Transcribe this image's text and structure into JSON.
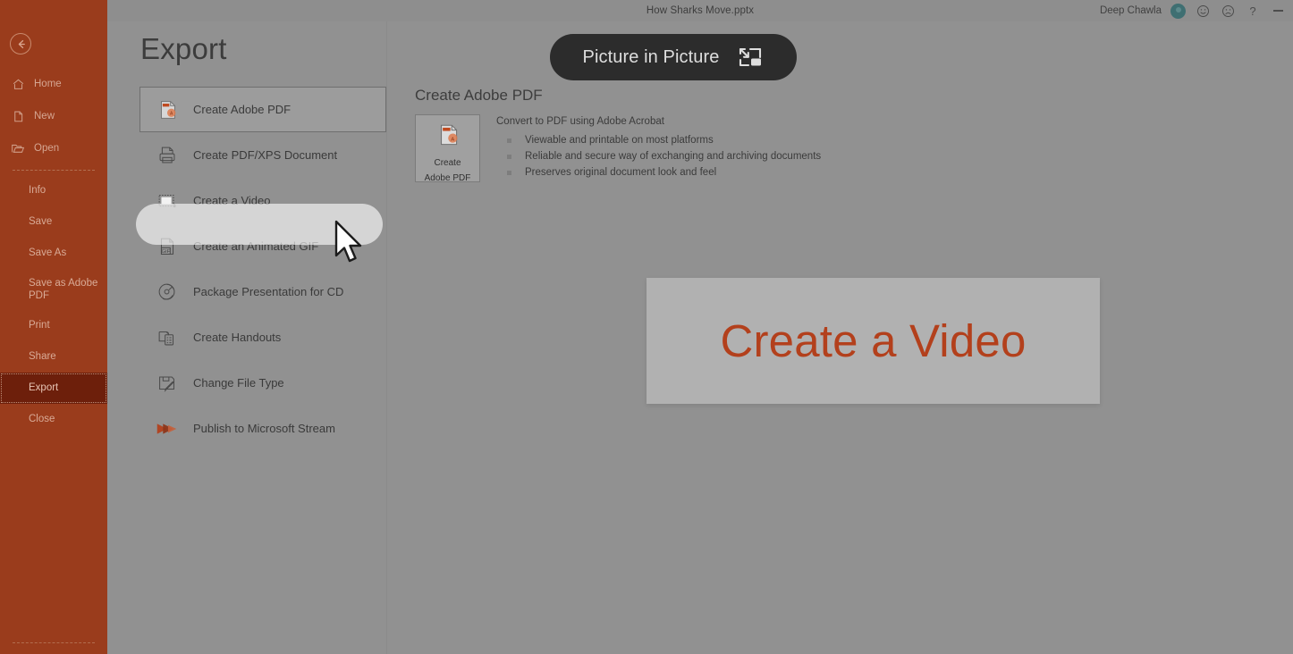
{
  "titlebar": {
    "doc_title": "How Sharks Move.pptx",
    "user_name": "Deep Chawla",
    "avatar_name": "avatar",
    "icons": {
      "smile": "smiley-face-icon",
      "frown": "frowning-face-icon",
      "help": "?",
      "minimize": "minimize-icon"
    },
    "accent_color": "#9a3c1c"
  },
  "leftnav": {
    "back_label": "back-arrow",
    "top_items": [
      {
        "label": "Home",
        "icon": "home-icon"
      },
      {
        "label": "New",
        "icon": "new-document-icon"
      },
      {
        "label": "Open",
        "icon": "open-folder-icon"
      }
    ],
    "sub_items": [
      {
        "label": "Info",
        "active": false
      },
      {
        "label": "Save",
        "active": false
      },
      {
        "label": "Save As",
        "active": false
      },
      {
        "label": "Save as Adobe PDF",
        "active": false
      },
      {
        "label": "Print",
        "active": false
      },
      {
        "label": "Share",
        "active": false
      },
      {
        "label": "Export",
        "active": true
      },
      {
        "label": "Close",
        "active": false
      }
    ],
    "active_color": "#6d1f0b"
  },
  "backstage": {
    "page_title": "Export",
    "commands": [
      {
        "label": "Create Adobe PDF",
        "icon": "adobe-pdf-icon",
        "selected": true
      },
      {
        "label": "Create PDF/XPS Document",
        "icon": "printer-document-icon",
        "selected": false
      },
      {
        "label": "Create a Video",
        "icon": "film-frame-icon",
        "selected": false
      },
      {
        "label": "Create an Animated GIF",
        "icon": "gif-document-icon",
        "selected": false
      },
      {
        "label": "Package Presentation for CD",
        "icon": "cd-disc-icon",
        "selected": false
      },
      {
        "label": "Create Handouts",
        "icon": "handouts-icon",
        "selected": false
      },
      {
        "label": "Change File Type",
        "icon": "floppy-pencil-icon",
        "selected": false
      },
      {
        "label": "Publish to Microsoft Stream",
        "icon": "stream-play-icon",
        "selected": false
      }
    ],
    "detail": {
      "heading": "Create Adobe PDF",
      "button_line1": "Create",
      "button_line2": "Adobe PDF",
      "lead": "Convert to PDF using Adobe Acrobat",
      "bullets": [
        "Viewable and printable on most platforms",
        "Reliable and secure way of exchanging and archiving documents",
        "Preserves original document look and feel"
      ]
    }
  },
  "pip": {
    "label": "Picture in Picture",
    "icon": "picture-in-picture-icon",
    "background": "#2c2c2c"
  },
  "overlay": {
    "text": "Create a Video",
    "text_color": "#b3401c"
  }
}
